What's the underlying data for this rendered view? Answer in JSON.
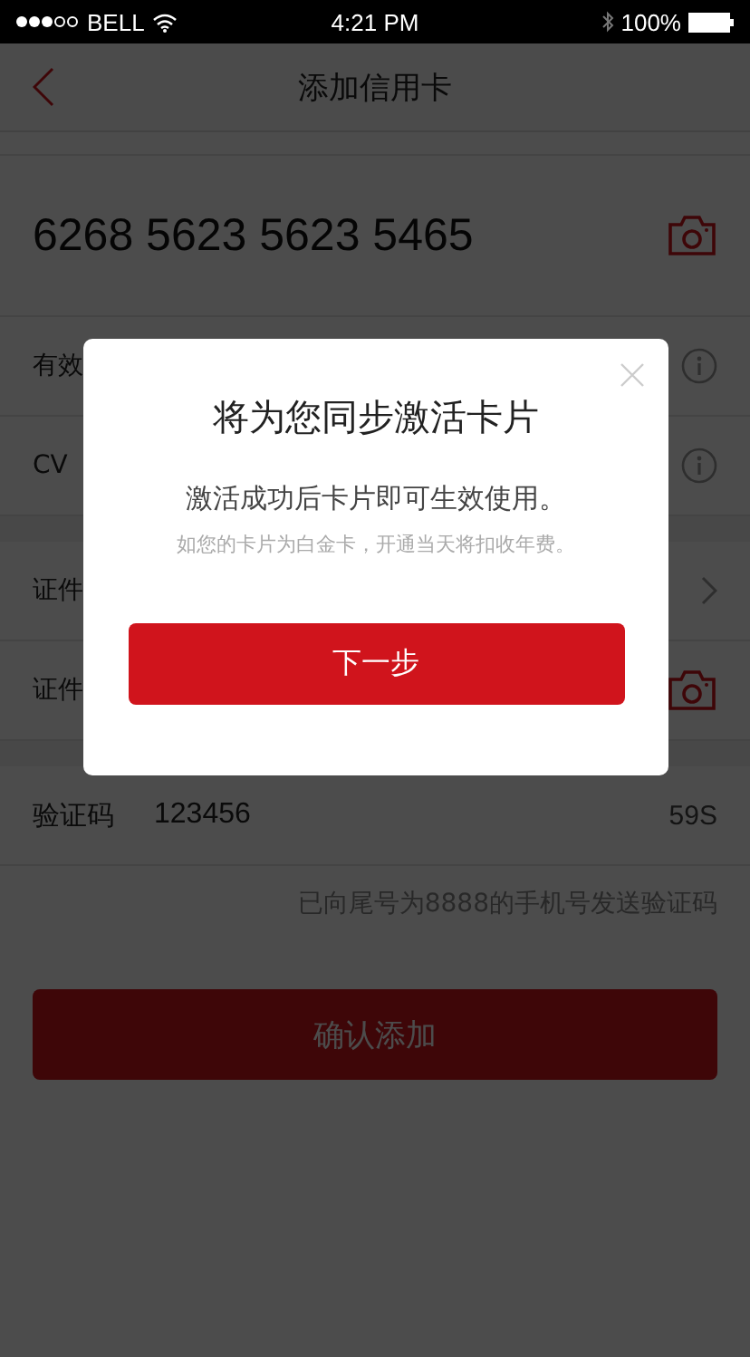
{
  "status_bar": {
    "carrier": "BELL",
    "time": "4:21 PM",
    "battery": "100%"
  },
  "nav": {
    "title": "添加信用卡"
  },
  "card_number": "6268 5623 5623 5465",
  "rows": [
    {
      "label": "有效",
      "kind": "info"
    },
    {
      "label": "CV",
      "kind": "info"
    },
    {
      "label": "证件",
      "kind": "chevron"
    },
    {
      "label": "证件",
      "kind": "camera"
    }
  ],
  "code_row": {
    "label": "验证码",
    "value": "123456",
    "countdown": "59S"
  },
  "hint": "已向尾号为8888的手机号发送验证码",
  "confirm_button": "确认添加",
  "dialog": {
    "title": "将为您同步激活卡片",
    "message": "激活成功后卡片即可生效使用。",
    "note": "如您的卡片为白金卡，开通当天将扣收年费。",
    "button": "下一步"
  }
}
